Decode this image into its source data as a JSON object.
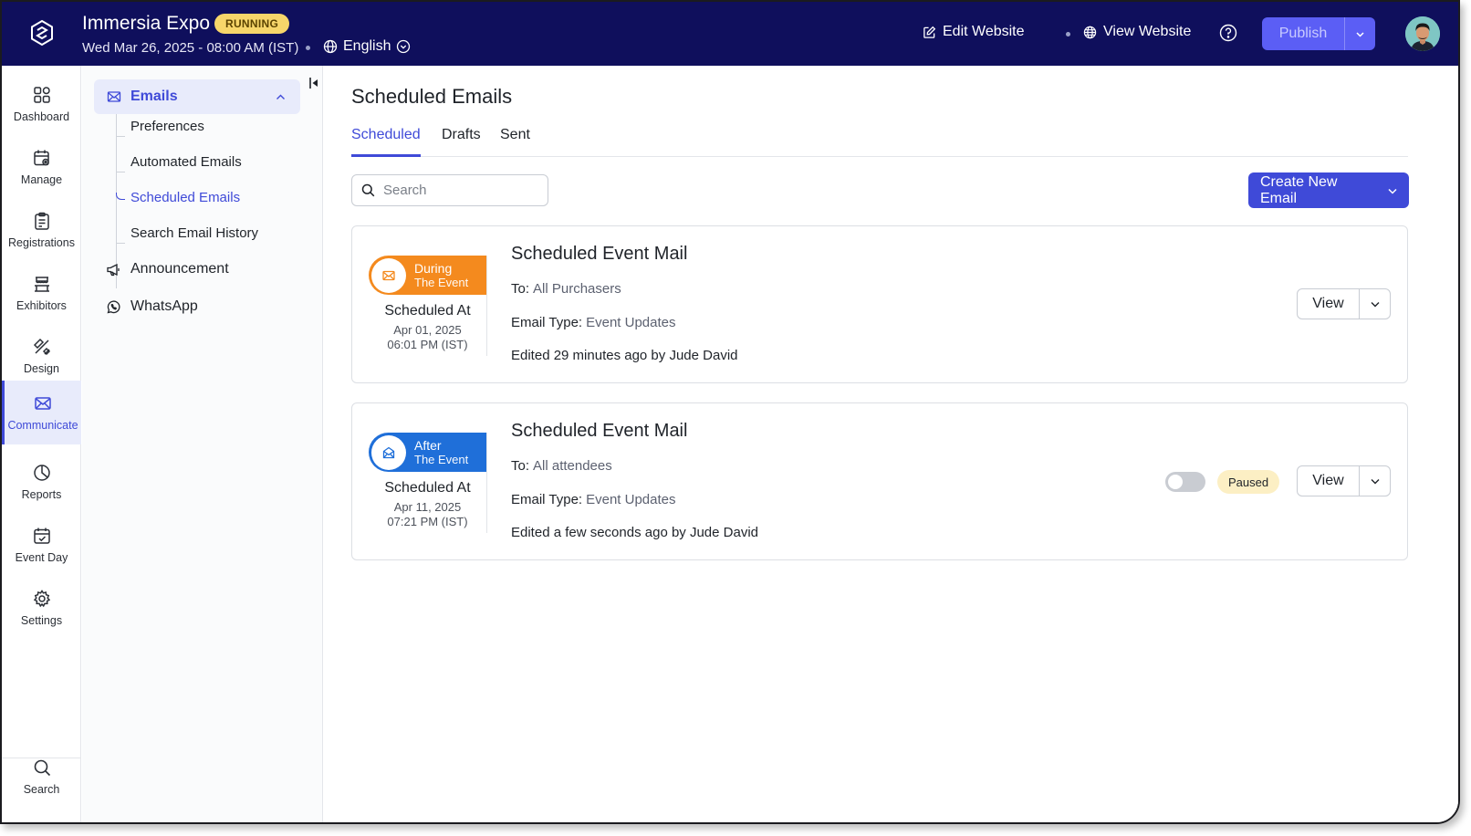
{
  "header": {
    "app_title": "Immersia Expo",
    "status_badge": "RUNNING",
    "datetime": "Wed Mar 26, 2025 - 08:00 AM (IST)",
    "language": "English",
    "edit_website": "Edit Website",
    "view_website": "View Website",
    "publish": "Publish",
    "colors": {
      "bar": "#0f0f5c",
      "badge": "#f7d66a",
      "publish": "#5b5ef5"
    }
  },
  "rail": {
    "items": [
      {
        "label": "Dashboard",
        "icon": "grid-icon"
      },
      {
        "label": "Manage",
        "icon": "calendar-gear-icon"
      },
      {
        "label": "Registrations",
        "icon": "clipboard-icon"
      },
      {
        "label": "Exhibitors",
        "icon": "booth-icon"
      },
      {
        "label": "Design",
        "icon": "pencil-ruler-icon"
      },
      {
        "label": "Communicate",
        "icon": "mail-icon",
        "active": true
      },
      {
        "label": "Reports",
        "icon": "pie-chart-icon"
      },
      {
        "label": "Event Day",
        "icon": "calendar-check-icon"
      },
      {
        "label": "Settings",
        "icon": "gear-icon"
      }
    ],
    "search": "Search"
  },
  "subnav": {
    "emails": "Emails",
    "children": [
      "Preferences",
      "Automated Emails",
      "Scheduled Emails",
      "Search Email History"
    ],
    "active_child": "Scheduled Emails",
    "announcement": "Announcement",
    "whatsapp": "WhatsApp"
  },
  "main": {
    "title": "Scheduled Emails",
    "tabs": [
      "Scheduled",
      "Drafts",
      "Sent"
    ],
    "active_tab": "Scheduled",
    "search_placeholder": "Search",
    "create_button": "Create New Email",
    "accent": "#3f4ad8"
  },
  "emails": [
    {
      "when_1": "During",
      "when_2": "The Event",
      "when_color": "#f48a1e",
      "scheduled_label": "Scheduled At",
      "date": "Apr 01, 2025",
      "time": "06:01 PM (IST)",
      "title": "Scheduled Event Mail",
      "to_label": "To:",
      "to": "All Purchasers",
      "type_label": "Email Type:",
      "type": "Event Updates",
      "edited": "Edited 29 minutes ago by",
      "editor": "Jude David",
      "view": "View"
    },
    {
      "when_1": "After",
      "when_2": "The Event",
      "when_color": "#1f6fd9",
      "scheduled_label": "Scheduled At",
      "date": "Apr 11, 2025",
      "time": "07:21 PM (IST)",
      "title": "Scheduled Event Mail",
      "to_label": "To:",
      "to": "All attendees",
      "type_label": "Email Type:",
      "type": "Event Updates",
      "edited": "Edited a few seconds ago by",
      "editor": "Jude David",
      "status": "Paused",
      "toggle_on": false,
      "view": "View"
    }
  ]
}
